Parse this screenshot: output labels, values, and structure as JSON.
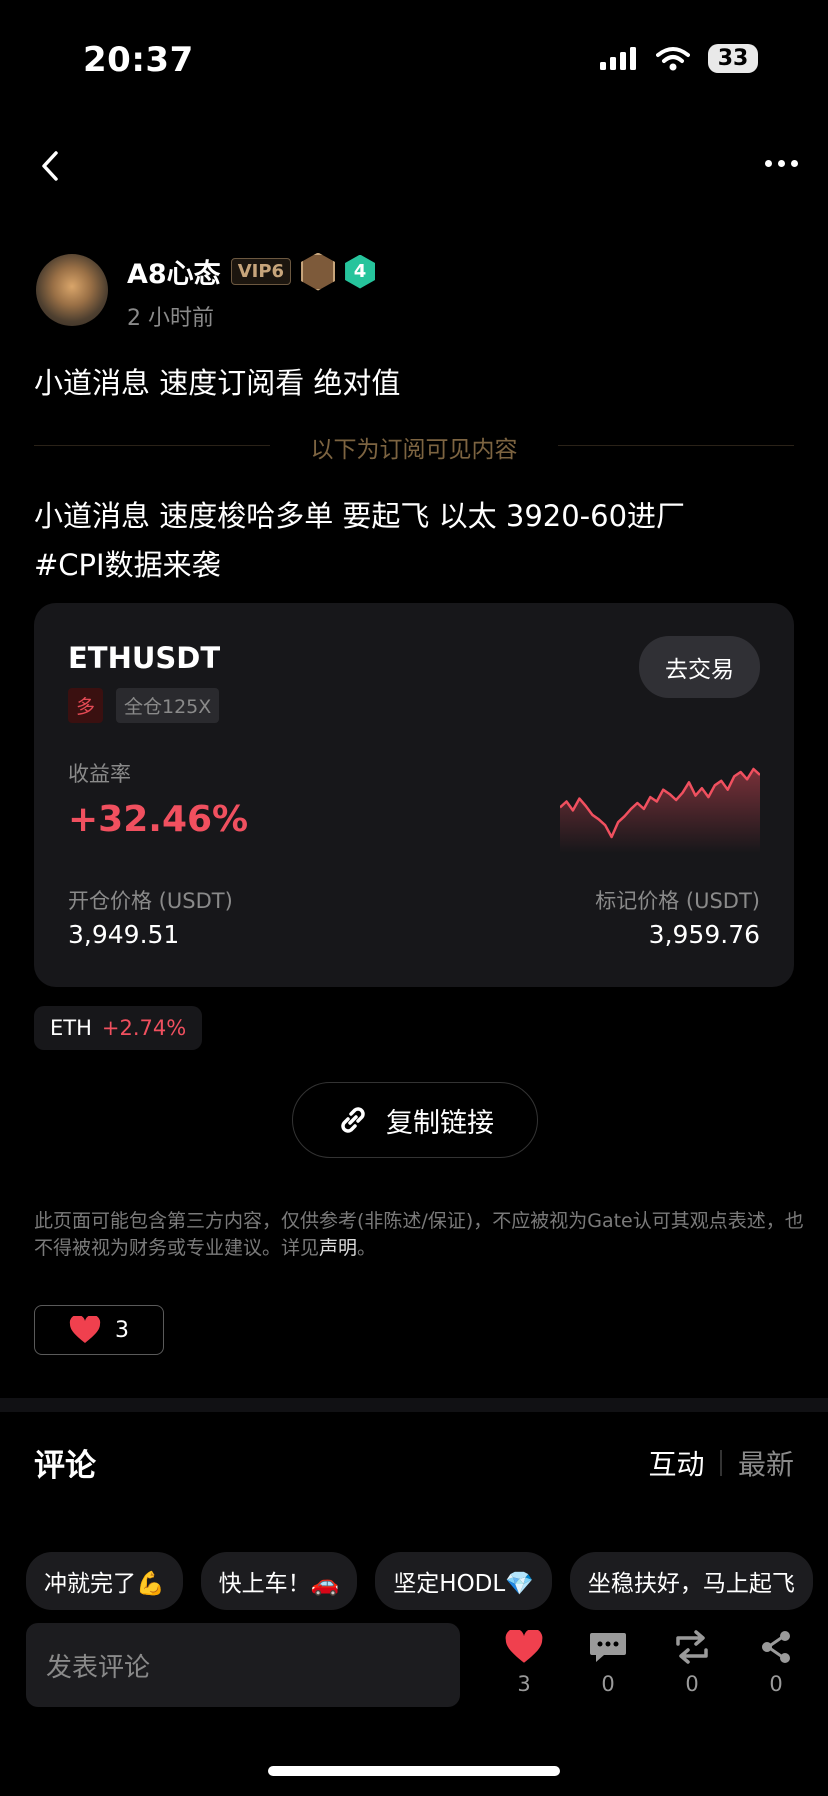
{
  "status_bar": {
    "time": "20:37",
    "battery": "33"
  },
  "author": {
    "name": "A8心态",
    "vip": "VIP6",
    "level": "4",
    "time": "2 小时前"
  },
  "post": {
    "line1": "小道消息 速度订阅看 绝对值",
    "subscriber_divider": "以下为订阅可见内容",
    "body_line1": "小道消息 速度梭哈多单 要起飞 以太 3920-60进厂",
    "body_line2": "#CPI数据来袭"
  },
  "trade_card": {
    "pair": "ETHUSDT",
    "side": "多",
    "leverage": "全仓125X",
    "trade_button": "去交易",
    "return_label": "收益率",
    "return_value": "+32.46%",
    "open_label": "开仓价格 (USDT)",
    "open_value": "3,949.51",
    "mark_label": "标记价格 (USDT)",
    "mark_value": "3,959.76",
    "sparkline": [
      3940,
      3944,
      3938,
      3946,
      3941,
      3935,
      3932,
      3928,
      3920,
      3930,
      3934,
      3939,
      3943,
      3939,
      3947,
      3944,
      3952,
      3949,
      3945,
      3950,
      3957,
      3948,
      3953,
      3947,
      3955,
      3958,
      3952,
      3961,
      3964,
      3959,
      3966,
      3962
    ]
  },
  "coin_tag": {
    "symbol": "ETH",
    "change": "+2.74%"
  },
  "copy_link": "复制链接",
  "disclaimer": {
    "text": "此页面可能包含第三方内容，仅供参考(非陈述/保证)，不应被视为Gate认可其观点表述，也不得被视为财务或专业建议。详见",
    "link": "声明",
    "end": "。"
  },
  "likes": {
    "count": "3"
  },
  "comments": {
    "title": "评论",
    "sort_interactive": "互动",
    "sort_latest": "最新",
    "quick_replies": [
      "冲就完了💪",
      "快上车！🚗",
      "坚定HODL💎",
      "坐稳扶好，马上起飞"
    ],
    "input_placeholder": "发表评论"
  },
  "actions": {
    "like_count": "3",
    "comment_count": "0",
    "repost_count": "0",
    "share_count": "0"
  },
  "colors": {
    "up": "#f0505f",
    "accent_gold": "#7d6441",
    "background": "#000000",
    "card": "#17171a"
  }
}
